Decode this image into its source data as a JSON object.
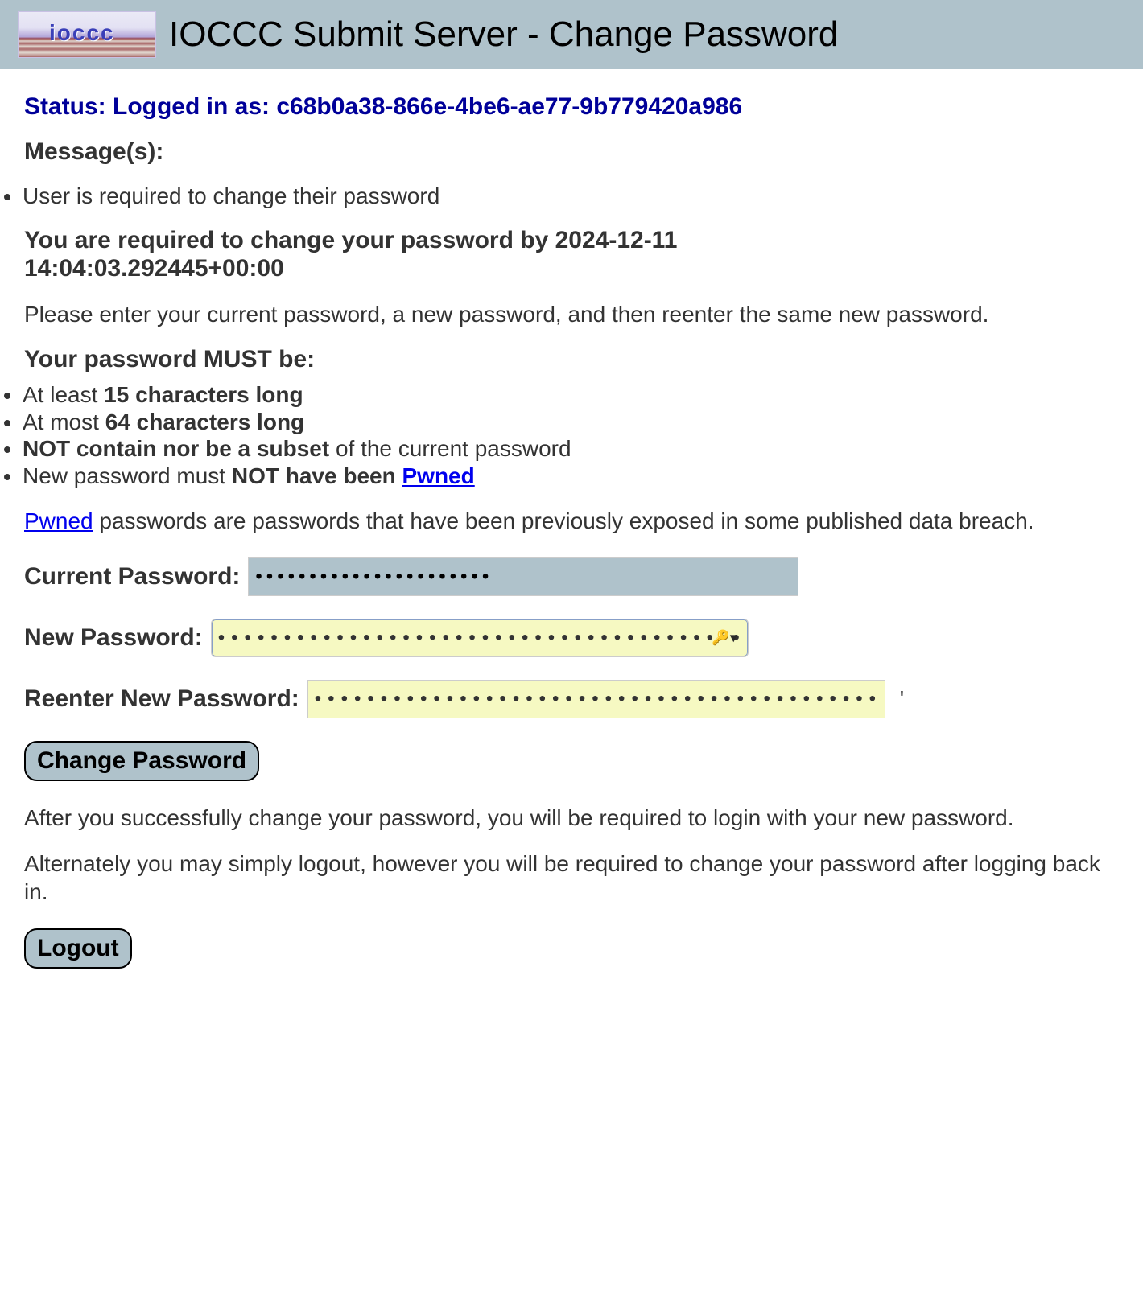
{
  "header": {
    "title": "IOCCC Submit Server - Change Password",
    "logo_alt": "ioccc"
  },
  "status": {
    "prefix": "Status: Logged in as: ",
    "user_id": "c68b0a38-866e-4be6-ae77-9b779420a986"
  },
  "messages": {
    "heading": "Message(s):",
    "items": [
      "User is required to change their password"
    ]
  },
  "deadline": {
    "line1": "You are required to change your password by 2024-12-11",
    "line2": "14:04:03.292445+00:00"
  },
  "instruction": "Please enter your current password, a new password, and then reenter the same new password.",
  "rules": {
    "heading": "Your password MUST be:",
    "r1_prefix": "At least ",
    "r1_bold": "15 characters long",
    "r2_prefix": "At most ",
    "r2_bold": "64 characters long",
    "r3_bold": "NOT contain nor be a subset",
    "r3_suffix": " of the current password",
    "r4_prefix": "New password must ",
    "r4_bold": "NOT have been ",
    "r4_link": "Pwned"
  },
  "pwned_explain": {
    "link": "Pwned",
    "rest": " passwords are passwords that have been previously exposed in some published data breach."
  },
  "fields": {
    "current_label": "Current Password:",
    "current_value": "••••••••••••••••••••••",
    "new_label": "New Password:",
    "new_value": "○ ○ ○ ○ ○ ○ ○ ○ ○ ○ ○ ○ ○ ○ ○ ○ ○ ○ ○ ○ ○ ○",
    "reenter_label": "Reenter New Password:",
    "reenter_value": "○ ○ ○ ○ ○ ○ ○ ○ ○ ○ ○ ○ ○ ○ ○ ○ ○ ○ ○ ○ ○ ○",
    "tick": "'"
  },
  "buttons": {
    "change": "Change Password",
    "logout": "Logout"
  },
  "after_text1": "After you successfully change your password, you will be required to login with your new password.",
  "after_text2": "Alternately you may simply logout, however you will be required to change your password after logging back in."
}
